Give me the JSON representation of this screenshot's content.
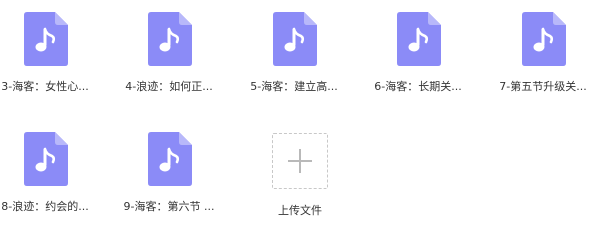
{
  "files": [
    {
      "name": "3-海客：女性心...",
      "icon": "music-note-file-icon"
    },
    {
      "name": "4-浪迹：如何正...",
      "icon": "music-note-file-icon"
    },
    {
      "name": "5-海客：建立高...",
      "icon": "music-note-file-icon"
    },
    {
      "name": "6-海客：长期关...",
      "icon": "music-note-file-icon"
    },
    {
      "name": "7-第五节升级关...",
      "icon": "music-note-file-icon"
    },
    {
      "name": "8-浪迹：约会的...",
      "icon": "music-note-file-icon"
    },
    {
      "name": "9-海客：第六节 ...",
      "icon": "music-note-file-icon"
    }
  ],
  "upload": {
    "label": "上传文件",
    "icon": "plus-icon"
  },
  "colors": {
    "file_icon": "#8B8BF7",
    "file_icon_fold": "#B8B8FA",
    "upload_border": "#C8C8C8",
    "plus": "#B9B9B9"
  }
}
